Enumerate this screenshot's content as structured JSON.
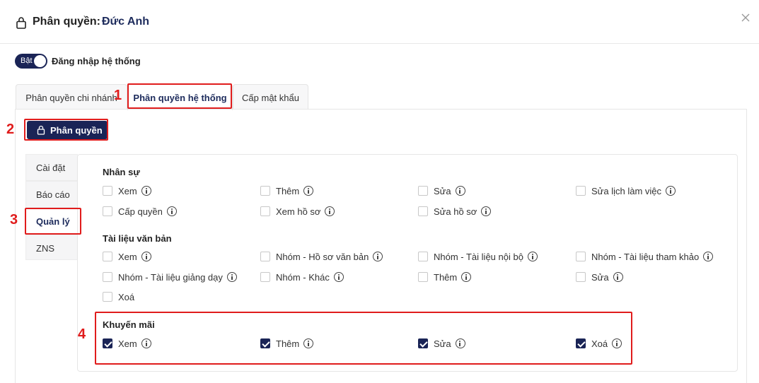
{
  "header": {
    "title_prefix": "Phân quyền:",
    "user_name": "Đức Anh"
  },
  "toggle": {
    "state_label": "Bật",
    "label": "Đăng nhập hệ thống",
    "on": true
  },
  "tabs": [
    {
      "label": "Phân quyền chi nhánh"
    },
    {
      "label": "Phân quyền hệ thống"
    },
    {
      "label": "Cấp mật khẩu"
    }
  ],
  "perm_button": {
    "label": "Phân quyền"
  },
  "vertical_tabs": [
    {
      "label": "Cài đặt"
    },
    {
      "label": "Báo cáo"
    },
    {
      "label": "Quản lý"
    },
    {
      "label": "ZNS"
    }
  ],
  "sections": [
    {
      "title": "Nhân sự",
      "items": [
        "Xem",
        "Thêm",
        "Sửa",
        "Sửa lịch làm việc",
        "Cấp quyền",
        "Xem hồ sơ",
        "Sửa hồ sơ"
      ]
    },
    {
      "title": "Tài liệu văn bản",
      "items": [
        "Xem",
        "Nhóm - Hồ sơ văn bản",
        "Nhóm - Tài liệu nội bộ",
        "Nhóm - Tài liệu tham khảo",
        "Nhóm - Tài liệu giảng dạy",
        "Nhóm - Khác",
        "Thêm",
        "Sửa",
        "Xoá"
      ]
    },
    {
      "title": "Khuyến mãi",
      "items": [
        "Xem",
        "Thêm",
        "Sửa",
        "Xoá"
      ]
    }
  ],
  "annotations": {
    "m1": "1",
    "m2": "2",
    "m3": "3",
    "m4": "4"
  },
  "colors": {
    "primary": "#1a2456",
    "annotation_red": "#e01c1c"
  }
}
